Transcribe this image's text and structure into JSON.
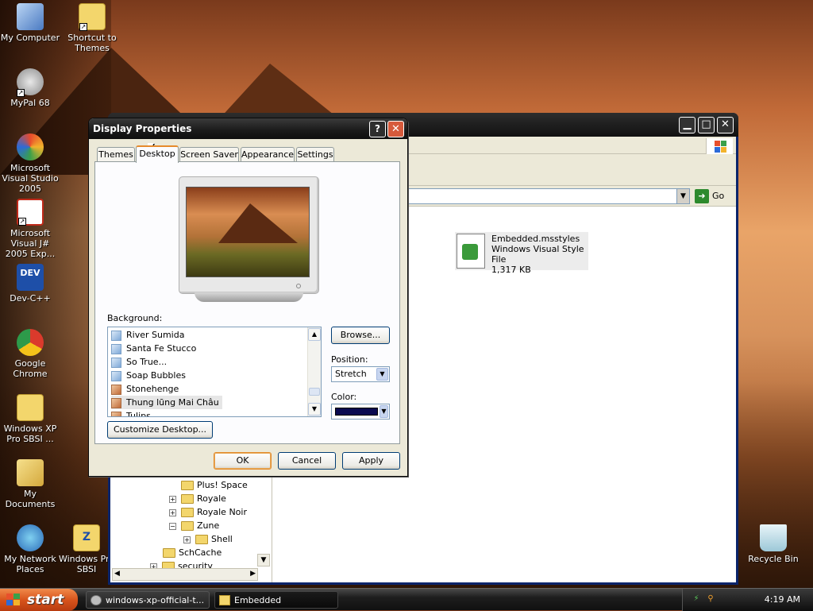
{
  "desktop": {
    "icons": [
      {
        "label": "My Computer"
      },
      {
        "label": "Shortcut to Themes"
      },
      {
        "label": "MyPal 68"
      },
      {
        "label": "Microsoft Visual Studio 2005"
      },
      {
        "label": "Microsoft Visual J# 2005 Exp..."
      },
      {
        "label": "Dev-C++",
        "badge": "DEV"
      },
      {
        "label": "Google Chrome"
      },
      {
        "label": "Windows XP Pro SBSI ..."
      },
      {
        "label": "My Documents"
      },
      {
        "label": "My Network Places"
      },
      {
        "label": "Windows Pro SBSI",
        "badge": "Z"
      },
      {
        "label": "Recycle Bin"
      }
    ]
  },
  "explorer": {
    "go_label": "Go",
    "file": {
      "name": "Embedded.msstyles",
      "type": "Windows Visual Style File",
      "size": "1,317 KB"
    },
    "tree": [
      {
        "label": "Plus! Space",
        "expander": ""
      },
      {
        "label": "Royale",
        "expander": "+"
      },
      {
        "label": "Royale Noir",
        "expander": "+"
      },
      {
        "label": "Zune",
        "expander": "−"
      },
      {
        "label": "Shell",
        "expander": "+"
      },
      {
        "label": "SchCache",
        "expander": ""
      },
      {
        "label": "security",
        "expander": "+"
      }
    ]
  },
  "dialog": {
    "title": "Display Properties",
    "help_glyph": "?",
    "close_glyph": "✕",
    "tabs": [
      {
        "label": "Themes"
      },
      {
        "label": "Desktop"
      },
      {
        "label": "Screen Saver"
      },
      {
        "label": "Appearance"
      },
      {
        "label": "Settings"
      }
    ],
    "active_tab": "Desktop",
    "background_label": "Background:",
    "backgrounds": [
      {
        "label": "River Sumida"
      },
      {
        "label": "Santa Fe Stucco"
      },
      {
        "label": "So True..."
      },
      {
        "label": "Soap Bubbles"
      },
      {
        "label": "Stonehenge"
      },
      {
        "label": "Thung lũng Mai Châu"
      },
      {
        "label": "Tulips"
      }
    ],
    "selected_background": "Thung lũng Mai Châu",
    "browse_label": "Browse...",
    "position_label": "Position:",
    "position_value": "Stretch",
    "color_label": "Color:",
    "color_value": "#0a0a50",
    "customize_label": "Customize Desktop...",
    "ok_label": "OK",
    "cancel_label": "Cancel",
    "apply_label": "Apply"
  },
  "taskbar": {
    "start_label": "start",
    "tasks": [
      {
        "label": "windows-xp-official-t..."
      },
      {
        "label": "Embedded"
      }
    ],
    "clock": "4:19 AM"
  }
}
